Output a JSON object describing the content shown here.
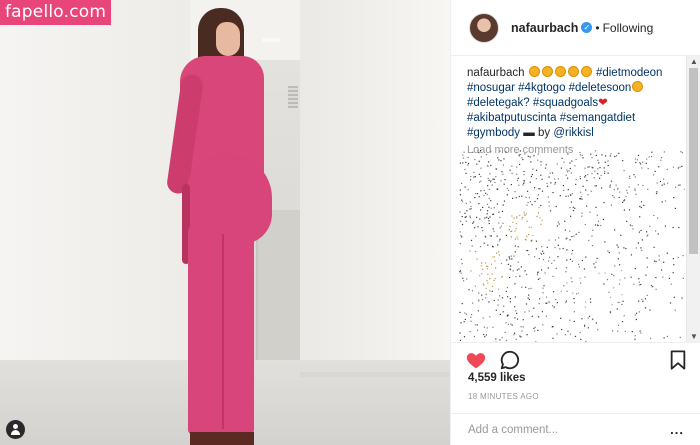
{
  "watermark": {
    "text": "fapello.com"
  },
  "header": {
    "username": "nafaurbach",
    "separator": "•",
    "follow_status": "Following"
  },
  "caption": {
    "username": "nafaurbach",
    "hashtags_line1": "#dietmodeon",
    "hashtags_line2": "#nosugar #4kgtogo #deletesoon",
    "hashtags_line3": "#deletegak? #squadgoals",
    "hashtags_line4": "#akibatputuscinta #semangatdiet",
    "hashtags_line5": "#gymbody",
    "by_text": "by",
    "mention": "@rikkisl"
  },
  "comments": {
    "load_more": "Load more comments"
  },
  "post": {
    "likes": "4,559 likes",
    "time": "18 MINUTES AGO"
  },
  "add_comment": {
    "placeholder": "Add a comment...",
    "more": "..."
  },
  "icons": {
    "like": "heart-filled-icon",
    "comment": "speech-bubble-icon",
    "save": "bookmark-icon",
    "verified": "verified-badge-icon",
    "user": "user-tag-icon"
  },
  "colors": {
    "accent": "#e8457b",
    "like": "#ed4956",
    "verified": "#3897f0",
    "link": "#003569"
  }
}
